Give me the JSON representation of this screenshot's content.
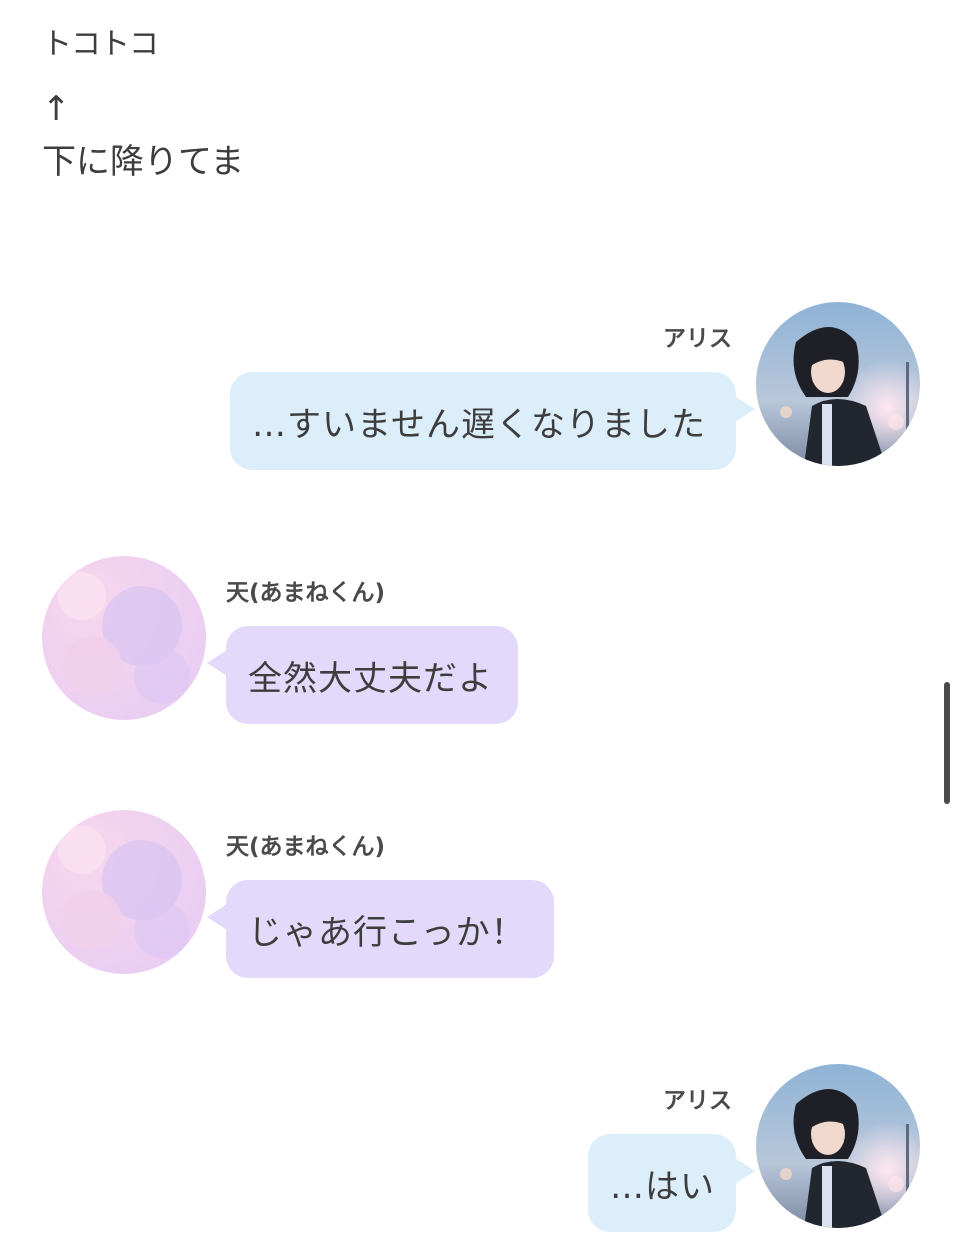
{
  "narration": {
    "sfx": "トコトコ",
    "arrow": "↑",
    "line": "下に降りてま"
  },
  "messages": [
    {
      "speaker": "アリス",
      "side": "right",
      "text": "…すいません遅くなりました",
      "avatar": "alice-avatar"
    },
    {
      "speaker": "天(あまねくん)",
      "side": "left",
      "text": "全然大丈夫だよ",
      "avatar": "amane-avatar"
    },
    {
      "speaker": "天(あまねくん)",
      "side": "left",
      "text": "じゃあ行こっか！",
      "avatar": "amane-avatar"
    },
    {
      "speaker": "アリス",
      "side": "right",
      "text": "…はい",
      "avatar": "alice-avatar"
    }
  ],
  "colors": {
    "right_bubble": "#ddeefb",
    "left_bubble": "#e3d9fa",
    "text": "#3d3d3d"
  }
}
